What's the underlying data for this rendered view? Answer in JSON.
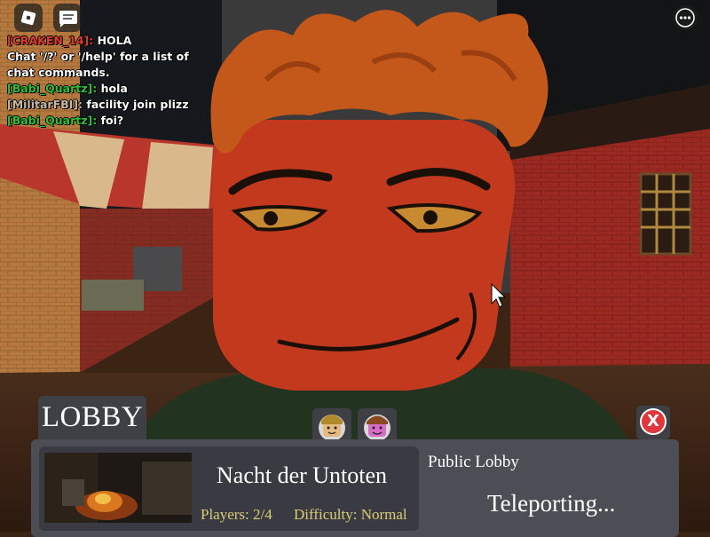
{
  "toolbar": {
    "roblox_icon": "roblox-logo-icon",
    "chat_icon": "chat-bubble-icon",
    "more_icon": "ellipsis-icon"
  },
  "chat": {
    "messages": [
      {
        "name": "[CRAKEN_14]:",
        "text": "HOLA",
        "name_color": "#e03b2e"
      },
      {
        "name": "",
        "text": "Chat '/?' or '/help' for a list of chat commands.",
        "name_color": "#ffffff"
      },
      {
        "name": "[Babi_Quartz]:",
        "text": "hola",
        "name_color": "#2fbf3a"
      },
      {
        "name": "[MilitarFBI]:",
        "text": "facility join plizz",
        "name_color": "#c8b9a6"
      },
      {
        "name": "[Babi_Quartz]:",
        "text": "foi?",
        "name_color": "#2fbf3a"
      }
    ]
  },
  "lobby": {
    "title": "LOBBY",
    "map_name": "Nacht der Untoten",
    "players": "Players: 2/4",
    "difficulty": "Difficulty: Normal",
    "lobby_type": "Public Lobby",
    "status": "Teleporting...",
    "close_label": "X"
  },
  "colors": {
    "panel": "#4d4e55",
    "card": "#3a3b42",
    "gold_text": "#d9cb77",
    "close_red": "#e0373a"
  }
}
